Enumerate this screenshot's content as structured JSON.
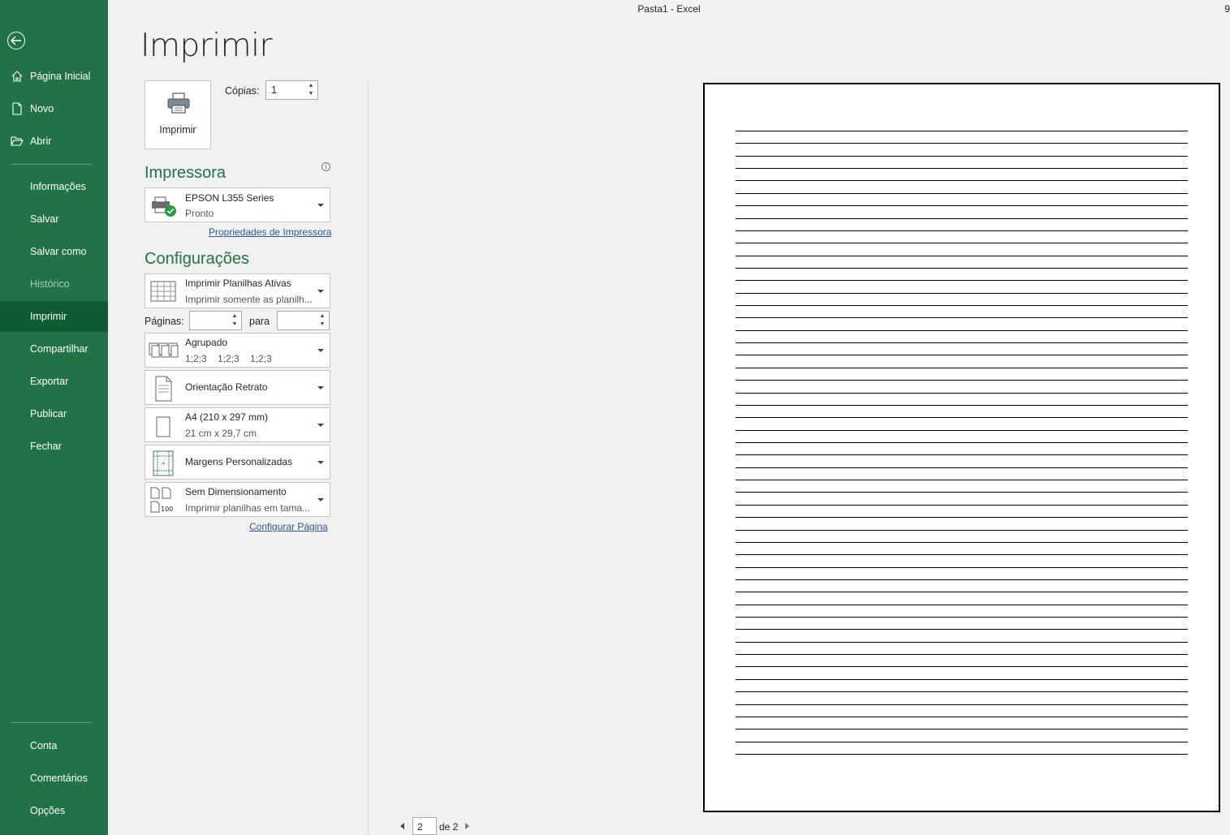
{
  "window": {
    "title": "Pasta1 - Excel",
    "trailing_glyph": "9"
  },
  "sidebar": {
    "top_items": [
      {
        "label": "Página Inicial",
        "icon": "home-icon"
      },
      {
        "label": "Novo",
        "icon": "new-document-icon"
      },
      {
        "label": "Abrir",
        "icon": "open-folder-icon"
      }
    ],
    "items": [
      {
        "label": "Informações"
      },
      {
        "label": "Salvar"
      },
      {
        "label": "Salvar como"
      },
      {
        "label": "Histórico",
        "disabled": true
      },
      {
        "label": "Imprimir",
        "active": true
      },
      {
        "label": "Compartilhar"
      },
      {
        "label": "Exportar"
      },
      {
        "label": "Publicar"
      },
      {
        "label": "Fechar"
      }
    ],
    "bottom_items": [
      {
        "label": "Conta"
      },
      {
        "label": "Comentários"
      },
      {
        "label": "Opções"
      }
    ]
  },
  "print": {
    "title": "Imprimir",
    "button_label": "Imprimir",
    "copies_label": "Cópias:",
    "copies_value": "1"
  },
  "printer": {
    "section_title": "Impressora",
    "name": "EPSON L355 Series",
    "status": "Pronto",
    "properties_link": "Propriedades de Impressora"
  },
  "settings": {
    "section_title": "Configurações",
    "what_to_print": {
      "line1": "Imprimir Planilhas Ativas",
      "line2": "Imprimir somente as planilh..."
    },
    "pages_label": "Páginas:",
    "pages_from": "",
    "pages_to_label": "para",
    "pages_to": "",
    "collation": {
      "line1": "Agrupado",
      "line2": "1;2;3    1;2;3    1;2;3"
    },
    "orientation": {
      "line1": "Orientação Retrato"
    },
    "paper": {
      "line1": "A4 (210 x 297 mm)",
      "line2": "21 cm x 29,7 cm"
    },
    "margins": {
      "line1": "Margens Personalizadas"
    },
    "scaling": {
      "line1": "Sem Dimensionamento",
      "line2": "Imprimir planilhas em tama...",
      "icon_text": "100"
    },
    "page_setup_link": "Configurar Página"
  },
  "preview": {
    "ruled_line_count": 51,
    "current_page": "2",
    "of_text": "de 2"
  }
}
